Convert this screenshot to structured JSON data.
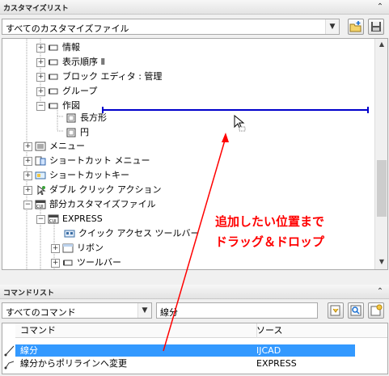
{
  "customize_panel": {
    "title": "カスタマイズリスト",
    "collapse_glyph": "⌃",
    "file_select": "すべてのカスタマイズファイル"
  },
  "tree_items": [
    {
      "label": "情報"
    },
    {
      "label": "表示順序 Ⅱ"
    },
    {
      "label": "ブロック エディタ : 管理"
    },
    {
      "label": "グループ"
    },
    {
      "label": "作図"
    },
    {
      "label": "長方形"
    },
    {
      "label": "円"
    },
    {
      "label": "メニュー"
    },
    {
      "label": "ショートカット メニュー"
    },
    {
      "label": "ショートカットキー"
    },
    {
      "label": "ダブル クリック アクション"
    },
    {
      "label": "部分カスタマイズファイル"
    },
    {
      "label": "EXPRESS"
    },
    {
      "label": "クイック アクセス ツールバー"
    },
    {
      "label": "リボン"
    },
    {
      "label": "ツールバー"
    }
  ],
  "command_panel": {
    "title": "コマンドリスト",
    "collapse_glyph": "⌃",
    "filter_select": "すべてのコマンド",
    "search_value": "線分",
    "columns": [
      "コマンド",
      "ソース"
    ],
    "rows": [
      {
        "command": "線分",
        "source": "IJCAD",
        "selected": true
      },
      {
        "command": "線分からポリラインへ変更",
        "source": "EXPRESS",
        "selected": false
      }
    ]
  },
  "annotation": {
    "line1": "追加したい位置まで",
    "line2": "ドラッグ＆ドロップ"
  },
  "colors": {
    "selection": "#3399ff",
    "drop_indicator": "#0000cc",
    "annotation": "#ff0000"
  }
}
